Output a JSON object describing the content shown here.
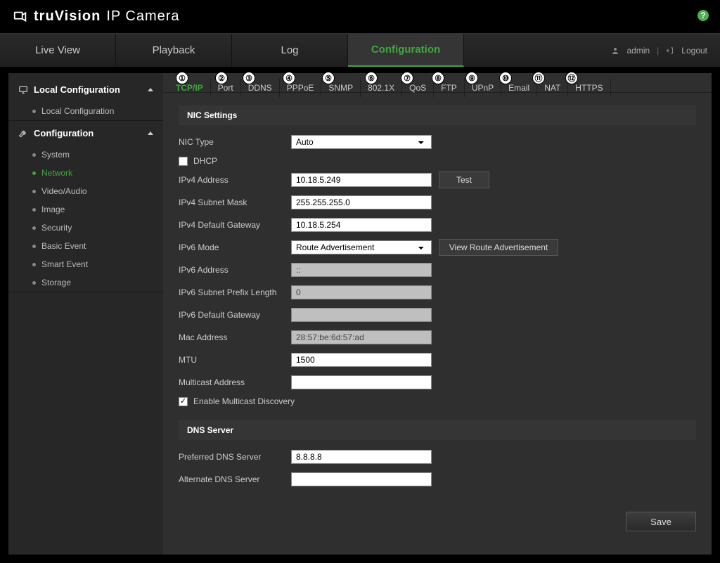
{
  "brand": {
    "name": "truVision",
    "subtitle": "IP Camera"
  },
  "help_icon_label": "?",
  "top_nav": {
    "live_view": "Live View",
    "playback": "Playback",
    "log": "Log",
    "configuration": "Configuration"
  },
  "user": {
    "name": "admin",
    "logout": "Logout"
  },
  "sidebar": {
    "local_cfg_header": "Local Configuration",
    "local_cfg_item": "Local Configuration",
    "cfg_header": "Configuration",
    "items": {
      "system": "System",
      "network": "Network",
      "video_audio": "Video/Audio",
      "image": "Image",
      "security": "Security",
      "basic_event": "Basic Event",
      "smart_event": "Smart Event",
      "storage": "Storage"
    }
  },
  "callouts": [
    "①",
    "②",
    "③",
    "④",
    "⑤",
    "⑥",
    "⑦",
    "⑧",
    "⑨",
    "⑩",
    "⑪",
    "⑫"
  ],
  "subtabs": {
    "tcpip": "TCP/IP",
    "port": "Port",
    "ddns": "DDNS",
    "pppoe": "PPPoE",
    "snmp": "SNMP",
    "8021x": "802.1X",
    "qos": "QoS",
    "ftp": "FTP",
    "upnp": "UPnP",
    "email": "Email",
    "nat": "NAT",
    "https": "HTTPS"
  },
  "nic": {
    "section_title": "NIC Settings",
    "nic_type_label": "NIC Type",
    "nic_type_value": "Auto",
    "dhcp_label": "DHCP",
    "dhcp_checked": false,
    "ipv4_addr_label": "IPv4 Address",
    "ipv4_addr_value": "10.18.5.249",
    "test_btn": "Test",
    "ipv4_mask_label": "IPv4 Subnet Mask",
    "ipv4_mask_value": "255.255.255.0",
    "ipv4_gw_label": "IPv4 Default Gateway",
    "ipv4_gw_value": "10.18.5.254",
    "ipv6_mode_label": "IPv6 Mode",
    "ipv6_mode_value": "Route Advertisement",
    "view_ra_btn": "View Route Advertisement",
    "ipv6_addr_label": "IPv6 Address",
    "ipv6_addr_value": "::",
    "ipv6_prefix_label": "IPv6 Subnet Prefix Length",
    "ipv6_prefix_value": "0",
    "ipv6_gw_label": "IPv6 Default Gateway",
    "ipv6_gw_value": "",
    "mac_label": "Mac Address",
    "mac_value": "28:57:be:6d:57:ad",
    "mtu_label": "MTU",
    "mtu_value": "1500",
    "multicast_label": "Multicast Address",
    "multicast_value": "",
    "enable_multicast_label": "Enable Multicast Discovery",
    "enable_multicast_checked": true
  },
  "dns": {
    "section_title": "DNS Server",
    "pref_label": "Preferred DNS Server",
    "pref_value": "8.8.8.8",
    "alt_label": "Alternate DNS Server",
    "alt_value": ""
  },
  "save_btn": "Save"
}
